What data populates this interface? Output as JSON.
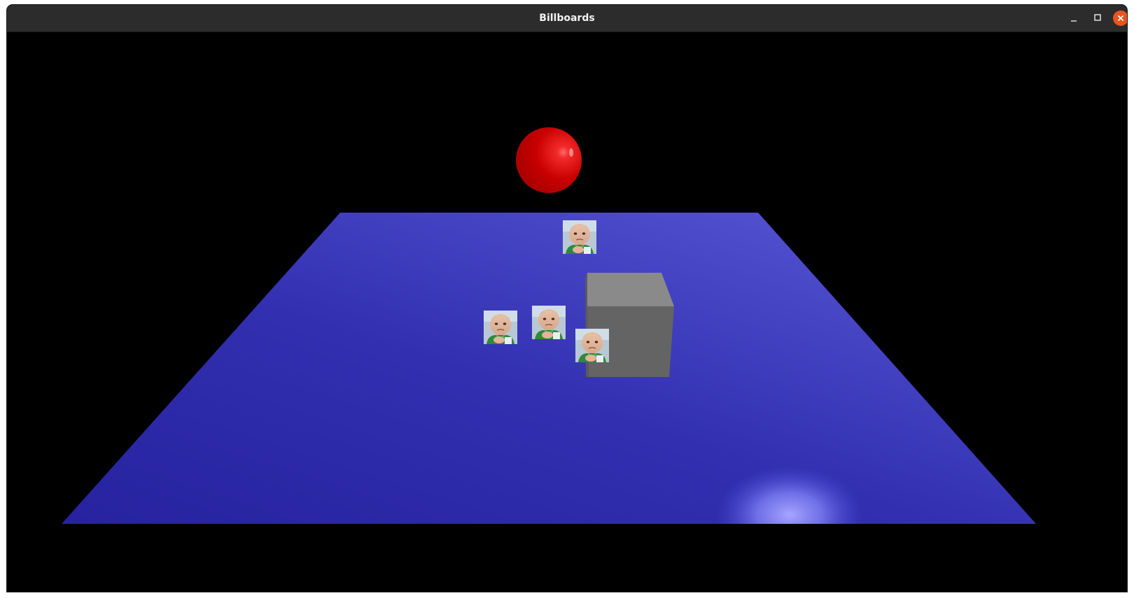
{
  "window": {
    "title": "Billboards"
  },
  "controls": {
    "minimize_icon": "minimize-icon",
    "maximize_icon": "maximize-icon",
    "close_icon": "close-icon"
  },
  "colors": {
    "titlebar": "#2c2c2c",
    "close_button": "#e95420",
    "floor": "#3532b5",
    "sphere": "#d10000",
    "cube": "#6a6a6a",
    "background": "#000000"
  },
  "scene": {
    "objects": [
      "floor-plane",
      "red-sphere",
      "gray-cube",
      "billboard-sprite",
      "billboard-sprite",
      "billboard-sprite",
      "billboard-sprite"
    ]
  }
}
